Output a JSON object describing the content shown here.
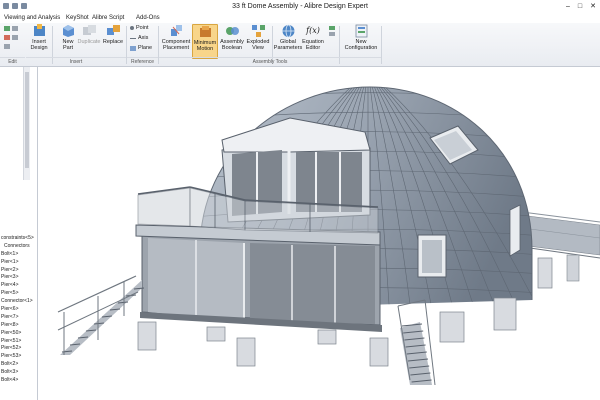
{
  "window": {
    "title": "33 ft Dome Assembly - Alibre Design Expert"
  },
  "menu": {
    "items": [
      {
        "label": "Viewing and Analysis"
      },
      {
        "label": "KeyShot"
      },
      {
        "label": "Alibre Script"
      },
      {
        "label": "Add-Ons"
      }
    ]
  },
  "ribbon": {
    "insert_design": "Insert Design",
    "new_part": "New Part",
    "duplicate": "Duplicate",
    "replace": "Replace",
    "point": "Point",
    "axis": "Axis",
    "plane": "Plane",
    "component_placement": "Component Placement",
    "minimum_motion": "Minimum Motion",
    "assembly_boolean": "Assembly Boolean",
    "exploded_view": "Exploded View",
    "global_parameters": "Global Parameters",
    "equation_editor": "Equation Editor",
    "equation_symbol": "f(x)",
    "new_configuration": "New Configuration",
    "groups": {
      "edit": "Edit",
      "insert": "Insert",
      "reference": "Reference",
      "assembly_tools": "Assembly Tools"
    },
    "active_color": "#f8d58a"
  },
  "tree": {
    "rows": [
      {
        "label": "constraints<5>",
        "indent": false
      },
      {
        "label": "Connectors",
        "indent": true
      },
      {
        "label": "Bolt<1>",
        "indent": false
      },
      {
        "label": "Pier<1>",
        "indent": false
      },
      {
        "label": "Pier<2>",
        "indent": false
      },
      {
        "label": "Pier<3>",
        "indent": false
      },
      {
        "label": "Pier<4>",
        "indent": false
      },
      {
        "label": "Pier<5>",
        "indent": false
      },
      {
        "label": "Connector<1>",
        "indent": false
      },
      {
        "label": "Pier<6>",
        "indent": false
      },
      {
        "label": "Pier<7>",
        "indent": false
      },
      {
        "label": "Pier<8>",
        "indent": false
      },
      {
        "label": "Pier<50>",
        "indent": false
      },
      {
        "label": "Pier<51>",
        "indent": false
      },
      {
        "label": "Pier<52>",
        "indent": false
      },
      {
        "label": "Pier<53>",
        "indent": false
      },
      {
        "label": "Bolt<2>",
        "indent": false
      },
      {
        "label": "Bolt<3>",
        "indent": false
      },
      {
        "label": "Bolt<4>",
        "indent": false
      }
    ]
  },
  "model": {
    "dome_color": "#8f9aa8",
    "dome_light": "#b9c2cd",
    "dome_dark": "#6f7a88",
    "railing_color": "#a0a7b1",
    "glass_color": "#cdd3da",
    "interior_color": "#7e858e"
  }
}
